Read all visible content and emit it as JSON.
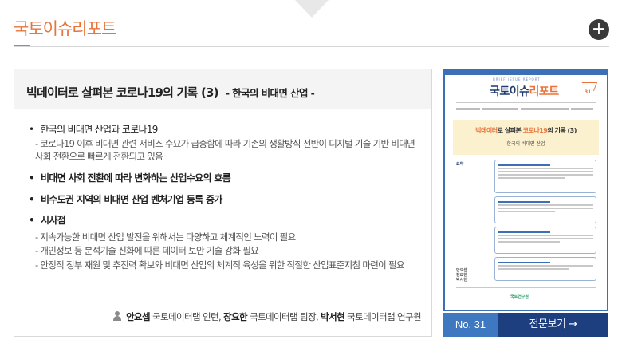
{
  "section": {
    "title": "국토이슈리포트",
    "more_icon": "+",
    "more_icon_name": "plus-circle-icon"
  },
  "article": {
    "title": "빅데이터로 살펴본 코로나19의 기록 (3)",
    "subtitle": "- 한국의 비대면 산업 -",
    "items": [
      {
        "label": "한국의 비대면 산업과 코로나19",
        "bold": false
      },
      {
        "label": "- 코로나19 이후 비대면 관련 서비스 수요가 급증함에 따라 기존의 생활방식 전반이 디지털 기술 기반 비대면 사회 전환으로 빠르게 전환되고 있음",
        "sub": true
      },
      {
        "label": "비대면 사회 전환에 따라 변화하는 산업수요의 흐름",
        "bold": true
      },
      {
        "label": "비수도권 지역의 비대면 산업 벤처기업 등록 증가",
        "bold": true
      },
      {
        "label": "시사점",
        "bold": true
      },
      {
        "label": "- 지속가능한 비대면 산업 발전을 위해서는 다양하고 체계적인 노력이 필요",
        "sub": true
      },
      {
        "label": "- 개인정보 등 분석기술 진화에 따른 데이터 보안 기술 강화 필요",
        "sub": true
      },
      {
        "label": "- 안정적 정부 재원 및 추진력 확보와 비대면 산업의 체계적 육성을 위한 적절한 산업표준지침 마련이 필요",
        "sub": true
      }
    ],
    "authors": {
      "icon": "person-icon",
      "a1_name": "안요셉",
      "a1_role": " 국토데이터랩 인턴, ",
      "a2_name": "장요한",
      "a2_role": " 국토데이터랩 팀장, ",
      "a3_name": "박서현",
      "a3_role": " 국토데이터랩 연구원"
    }
  },
  "cover": {
    "tag": "BRIEF ISSUE REPORT",
    "brand_a": "국토이슈",
    "brand_b": "리포트",
    "number": "31",
    "headline_a": "빅데이터",
    "headline_b": "로 살펴본 ",
    "headline_c": "코로나19",
    "headline_d": "의 기록 (3)",
    "subhead": "- 한국의 비대면 산업 -",
    "summary_label": "요약",
    "author_label": "안요셉\n장요한\n박서현",
    "logo": "국토연구원"
  },
  "footer": {
    "issue": "No. 31",
    "full_view": "전문보기 →"
  },
  "colors": {
    "accent": "#e8743b",
    "navy": "#1e3f7f",
    "blue": "#3d78c0"
  }
}
